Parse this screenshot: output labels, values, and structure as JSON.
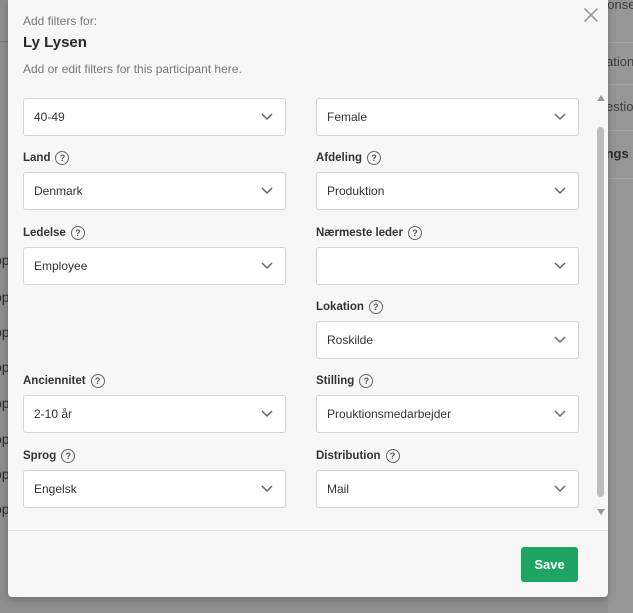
{
  "background": {
    "right_texts": [
      "ponse",
      "ation",
      "estio",
      "ings"
    ],
    "left_fragment": "op"
  },
  "modal": {
    "pre_title": "Add filters for:",
    "title": "Ly Lysen",
    "subtitle": "Add or edit filters for this participant here.",
    "save_label": "Save"
  },
  "fields": {
    "age": {
      "value": "40-49"
    },
    "gender": {
      "value": "Female"
    },
    "land": {
      "label": "Land",
      "value": "Denmark"
    },
    "afdeling": {
      "label": "Afdeling",
      "value": "Produktion"
    },
    "ledelse": {
      "label": "Ledelse",
      "value": "Employee"
    },
    "naermeste_leder": {
      "label": "Nærmeste leder",
      "value": ""
    },
    "lokation": {
      "label": "Lokation",
      "value": "Roskilde"
    },
    "anciennitet": {
      "label": "Anciennitet",
      "value": "2-10 år"
    },
    "stilling": {
      "label": "Stilling",
      "value": "Prouktionsmedarbejder"
    },
    "sprog": {
      "label": "Sprog",
      "value": "Engelsk"
    },
    "distribution": {
      "label": "Distribution",
      "value": "Mail"
    }
  },
  "help_glyph": "?",
  "colors": {
    "save": "#1fa463",
    "overlay": "#8e8e8e",
    "modal_bg": "#f7f7f7"
  }
}
